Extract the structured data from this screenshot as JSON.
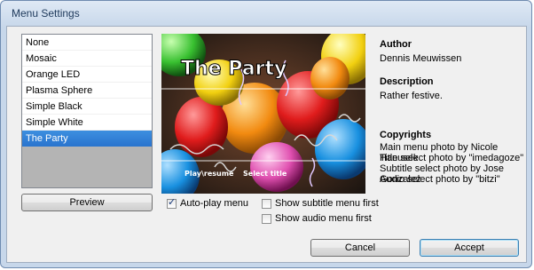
{
  "window": {
    "title": "Menu Settings"
  },
  "styles": {
    "items": [
      {
        "label": "None"
      },
      {
        "label": "Mosaic"
      },
      {
        "label": "Orange LED"
      },
      {
        "label": "Plasma Sphere"
      },
      {
        "label": "Simple Black"
      },
      {
        "label": "Simple White"
      },
      {
        "label": "The Party",
        "selected": true
      }
    ]
  },
  "preview_button": "Preview",
  "preview": {
    "title": "The Party",
    "play_label": "Play\\resume",
    "select_label": "Select title"
  },
  "info": {
    "author_heading": "Author",
    "author": "Dennis Meuwissen",
    "description_heading": "Description",
    "description": "Rather festive.",
    "copyrights_heading": "Copyrights",
    "copyrights": [
      "Main menu photo by Nicole Hanusek",
      "Title select photo by \"imedagoze\"",
      "Subtitle select photo by Jose Gonzalez",
      "Audio select photo by \"bitzi\""
    ]
  },
  "options": {
    "autoplay": {
      "label": "Auto-play menu",
      "checked": true
    },
    "subtitle_first": {
      "label": "Show subtitle menu first",
      "checked": false
    },
    "audio_first": {
      "label": "Show audio menu first",
      "checked": false
    }
  },
  "buttons": {
    "cancel": "Cancel",
    "accept": "Accept"
  }
}
